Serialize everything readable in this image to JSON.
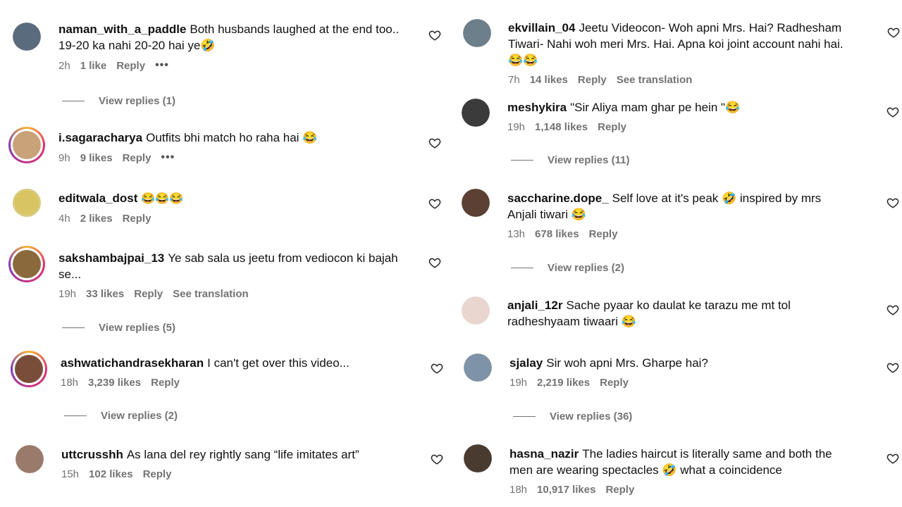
{
  "left": [
    {
      "user": "naman_with_a_paddle",
      "text": "Both husbands laughed at the end too.. 19-20 ka nahi 20-20 hai ye🤣",
      "time": "2h",
      "likes": "1 like",
      "reply": "Reply",
      "more": "•••",
      "replies": "View replies (1)",
      "avatar_color": "#5a6b7d"
    },
    {
      "user": "i.sagaracharya",
      "text": "Outfits bhi match ho raha hai 😂",
      "time": "9h",
      "likes": "9 likes",
      "reply": "Reply",
      "more": "•••",
      "avatar_color": "#c9a27a"
    },
    {
      "user": "editwala_dost",
      "text": "😂😂😂",
      "time": "4h",
      "likes": "2 likes",
      "reply": "Reply",
      "avatar_color": "#d9c463"
    },
    {
      "user": "sakshambajpai_13",
      "text": "Ye sab sala us jeetu from vediocon ki bajah se...",
      "time": "19h",
      "likes": "33 likes",
      "reply": "Reply",
      "translate": "See translation",
      "replies": "View replies (5)",
      "avatar_color": "#8a6a3c"
    },
    {
      "user": "ashwatichandrasekharan",
      "text": "I can't get over this video...",
      "time": "18h",
      "likes": "3,239 likes",
      "reply": "Reply",
      "replies": "View replies (2)",
      "avatar_color": "#7a4d3b"
    },
    {
      "user": "uttcrusshh",
      "text": "As lana del rey rightly sang “life imitates art”",
      "time": "15h",
      "likes": "102 likes",
      "reply": "Reply",
      "avatar_color": "#9a7a6a"
    }
  ],
  "right": [
    {
      "user": "ekvillain_04",
      "text": "Jeetu Videocon- Woh apni Mrs. Hai? Radhesham Tiwari- Nahi woh meri Mrs. Hai. Apna koi joint account nahi hai.😂😂",
      "time": "7h",
      "likes": "14 likes",
      "reply": "Reply",
      "translate": "See translation",
      "avatar_color": "#6d7f8a"
    },
    {
      "user": "meshykira",
      "text": "\"Sir Aliya mam ghar pe hein \"😂",
      "time": "19h",
      "likes": "1,148 likes",
      "reply": "Reply",
      "replies": "View replies (11)",
      "avatar_color": "#3b3b3b"
    },
    {
      "user": "saccharine.dope_",
      "text": "Self love at it's peak 🤣 inspired by mrs Anjali tiwari 😂",
      "time": "13h",
      "likes": "678 likes",
      "reply": "Reply",
      "replies": "View replies (2)",
      "avatar_color": "#5b4033"
    },
    {
      "user": "anjali_12r",
      "text": "Sache pyaar ko daulat ke tarazu me mt tol radheshyaam tiwaari 😂",
      "time": "",
      "likes": "",
      "reply": "",
      "avatar_color": "#e8d6cf"
    },
    {
      "user": "sjalay",
      "text": "Sir woh apni Mrs. Gharpe hai?",
      "time": "19h",
      "likes": "2,219 likes",
      "reply": "Reply",
      "replies": "View replies (36)",
      "avatar_color": "#7f93a8"
    },
    {
      "user": "hasna_nazir",
      "text": "The ladies haircut is literally same and both the men are wearing spectacles 🤣 what a coincidence",
      "time": "18h",
      "likes": "10,917 likes",
      "reply": "Reply",
      "avatar_color": "#4a3b30"
    }
  ],
  "colors": {
    "meta": "#737373",
    "text": "#111111",
    "ring_accent": "#e1306c"
  },
  "icons": {
    "like": "heart-outline-icon"
  }
}
